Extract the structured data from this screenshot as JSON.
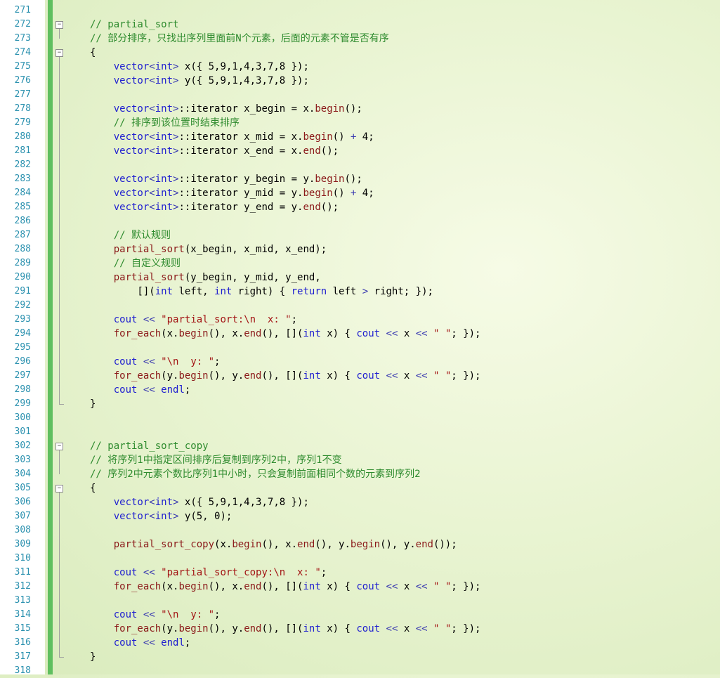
{
  "editor": {
    "line_numbers": [
      "271",
      "272",
      "273",
      "274",
      "275",
      "276",
      "277",
      "278",
      "279",
      "280",
      "281",
      "282",
      "283",
      "284",
      "285",
      "286",
      "287",
      "288",
      "289",
      "290",
      "291",
      "292",
      "293",
      "294",
      "295",
      "296",
      "297",
      "298",
      "299",
      "300",
      "301",
      "302",
      "303",
      "304",
      "305",
      "306",
      "307",
      "308",
      "309",
      "310",
      "311",
      "312",
      "313",
      "314",
      "315",
      "316",
      "317",
      "318"
    ],
    "fold_icons": [
      "minus-box",
      "minus-box",
      "minus-box",
      "minus-box"
    ],
    "lines": [
      "",
      "// partial_sort",
      "// 部分排序，只找出序列里面前N个元素，后面的元素不管是否有序",
      "{",
      "    vector<int> x({ 5,9,1,4,3,7,8 });",
      "    vector<int> y({ 5,9,1,4,3,7,8 });",
      "",
      "    vector<int>::iterator x_begin = x.begin();",
      "    // 排序到该位置时结束排序",
      "    vector<int>::iterator x_mid = x.begin() + 4;",
      "    vector<int>::iterator x_end = x.end();",
      "",
      "    vector<int>::iterator y_begin = y.begin();",
      "    vector<int>::iterator y_mid = y.begin() + 4;",
      "    vector<int>::iterator y_end = y.end();",
      "",
      "    // 默认规则",
      "    partial_sort(x_begin, x_mid, x_end);",
      "    // 自定义规则",
      "    partial_sort(y_begin, y_mid, y_end,",
      "        [](int left, int right) { return left > right; });",
      "",
      "    cout << \"partial_sort:\\n  x: \";",
      "    for_each(x.begin(), x.end(), [](int x) { cout << x << \" \"; });",
      "",
      "    cout << \"\\n  y: \";",
      "    for_each(y.begin(), y.end(), [](int x) { cout << x << \" \"; });",
      "    cout << endl;",
      "}",
      "",
      "",
      "// partial_sort_copy",
      "// 将序列1中指定区间排序后复制到序列2中，序列1不变",
      "// 序列2中元素个数比序列1中小时，只会复制前面相同个数的元素到序列2",
      "{",
      "    vector<int> x({ 5,9,1,4,3,7,8 });",
      "    vector<int> y(5, 0);",
      "",
      "    partial_sort_copy(x.begin(), x.end(), y.begin(), y.end());",
      "",
      "    cout << \"partial_sort_copy:\\n  x: \";",
      "    for_each(x.begin(), x.end(), [](int x) { cout << x << \" \"; });",
      "",
      "    cout << \"\\n  y: \";",
      "    for_each(y.begin(), y.end(), [](int x) { cout << x << \" \"; });",
      "    cout << endl;",
      "}",
      ""
    ],
    "colors": {
      "line_number": "#2b91af",
      "comment": "#2e8b2e",
      "keyword": "#2020d0",
      "function": "#8b1a1a",
      "string": "#a31515",
      "change_bar": "#5fbf5f"
    }
  }
}
